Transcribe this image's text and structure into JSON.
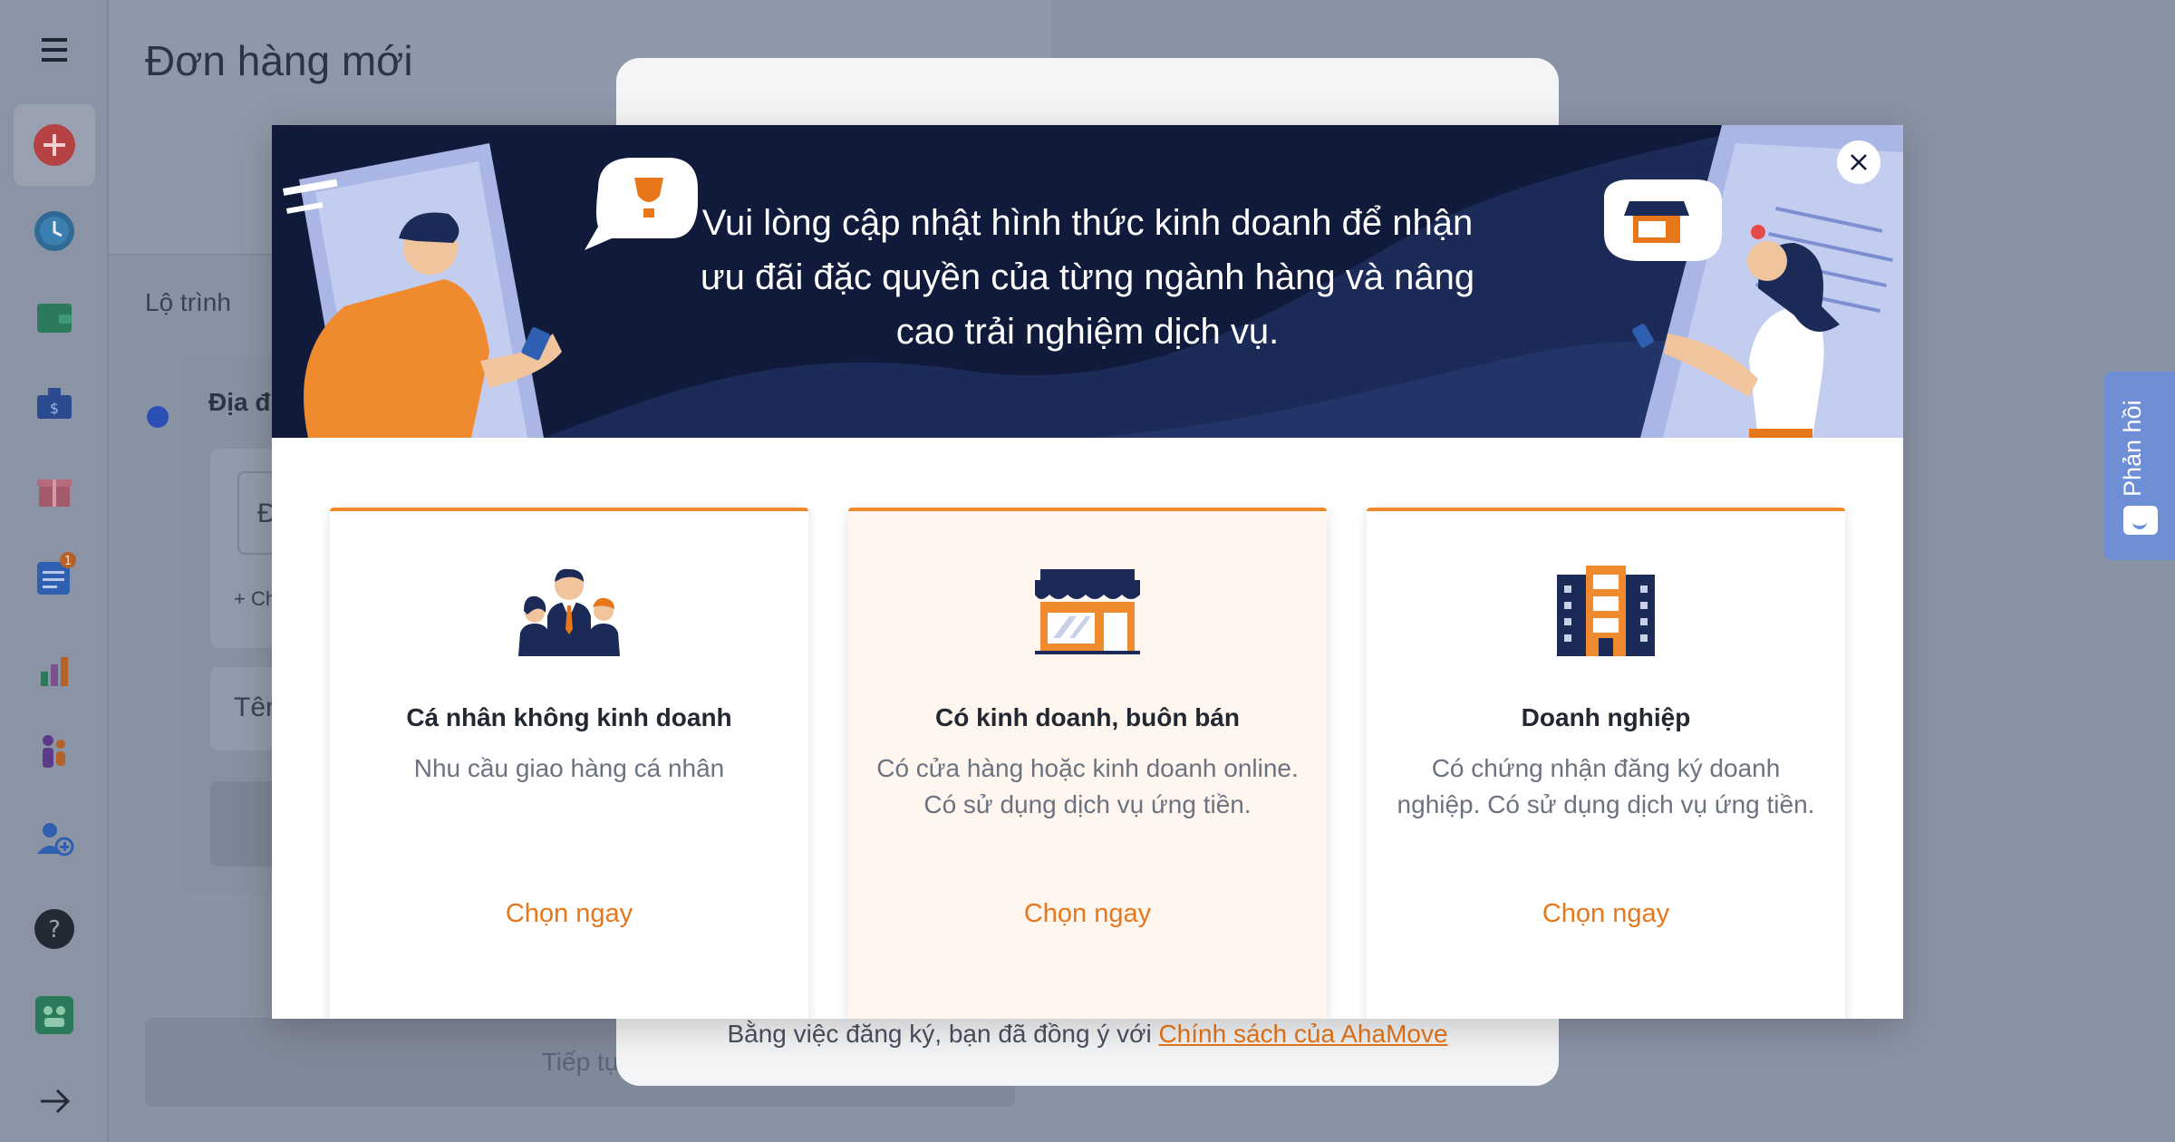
{
  "app": {
    "page_title": "Đơn hàng mới",
    "route_label": "Lộ trình",
    "address_label_partial": "Địa đi",
    "address_input_partial": "Đ",
    "add_stop_partial": "+ Ch",
    "name_input_partial": "Tên",
    "continue_partial": "Tiếp tụ",
    "badge_count": "1"
  },
  "sidebar": {
    "icons": [
      "menu-icon",
      "add-order-icon",
      "history-clock-icon",
      "wallet-icon",
      "money-bag-icon",
      "gift-icon",
      "orders-list-icon",
      "chart-icon",
      "people-icon",
      "add-user-icon",
      "help-icon",
      "team-icon",
      "arrow-right-icon"
    ]
  },
  "feedback": {
    "label": "Phản hồi"
  },
  "modal": {
    "banner_text": "Vui lòng cập nhật hình thức kinh doanh để nhận ưu đãi đặc quyền của từng ngành hàng và nâng cao trải nghiệm dịch vụ.",
    "options": [
      {
        "title": "Cá nhân không kinh doanh",
        "desc": "Nhu cầu giao hàng cá nhân",
        "action": "Chọn ngay",
        "icon": "individuals-icon"
      },
      {
        "title": "Có kinh doanh, buôn bán",
        "desc": "Có cửa hàng hoặc kinh doanh online. Có sử dụng dịch vụ ứng tiền.",
        "action": "Chọn ngay",
        "icon": "shop-icon"
      },
      {
        "title": "Doanh nghiệp",
        "desc": "Có chứng nhận đăng ký doanh nghiệp. Có sử dụng dịch vụ ứng tiền.",
        "action": "Chọn ngay",
        "icon": "building-icon"
      }
    ]
  },
  "consent": {
    "text": "Bằng việc đăng ký, bạn đã đồng ý với ",
    "link": "Chính sách của AhaMove"
  },
  "colors": {
    "accent": "#e8761a",
    "banner_bg": "#101a3b",
    "card_border": "#f08a2e"
  }
}
